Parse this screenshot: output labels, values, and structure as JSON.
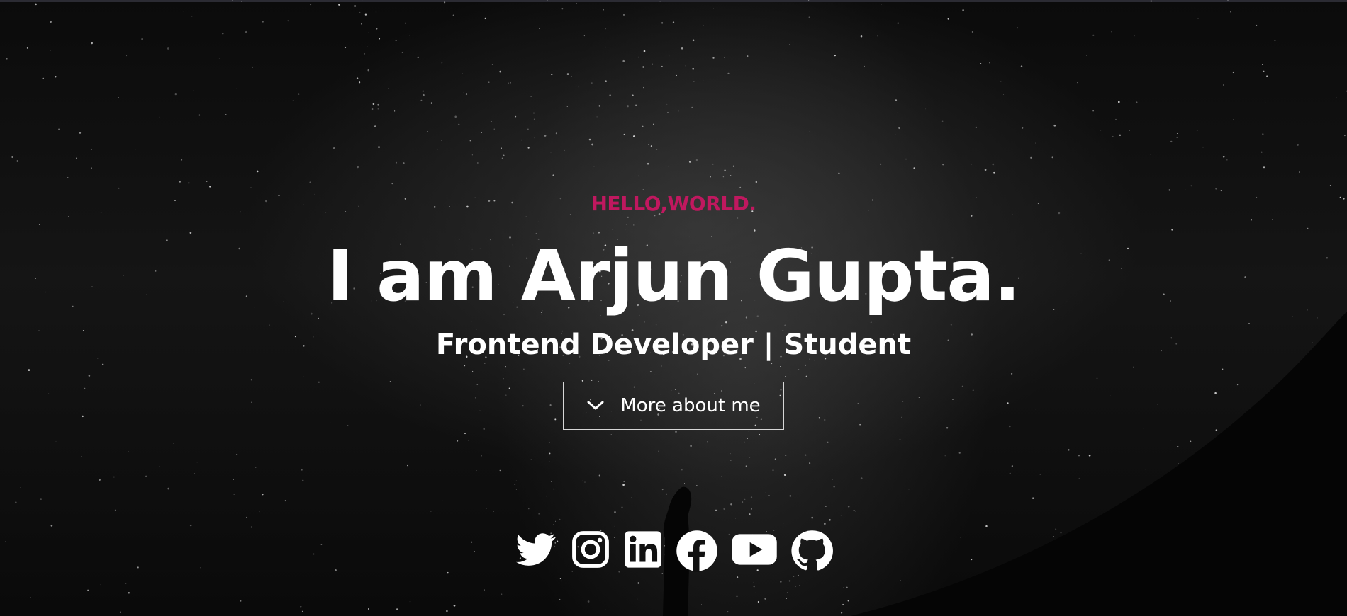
{
  "hero": {
    "greeting": "HELLO,WORLD.",
    "title": "I am Arjun Gupta.",
    "tagline": "Frontend Developer | Student",
    "cta_label": "More about me"
  },
  "colors": {
    "accent": "#c0185f",
    "text": "#ffffff",
    "background": "#0b0b0b"
  },
  "social_icons": [
    "twitter-icon",
    "instagram-icon",
    "linkedin-icon",
    "facebook-icon",
    "youtube-icon",
    "github-icon"
  ]
}
